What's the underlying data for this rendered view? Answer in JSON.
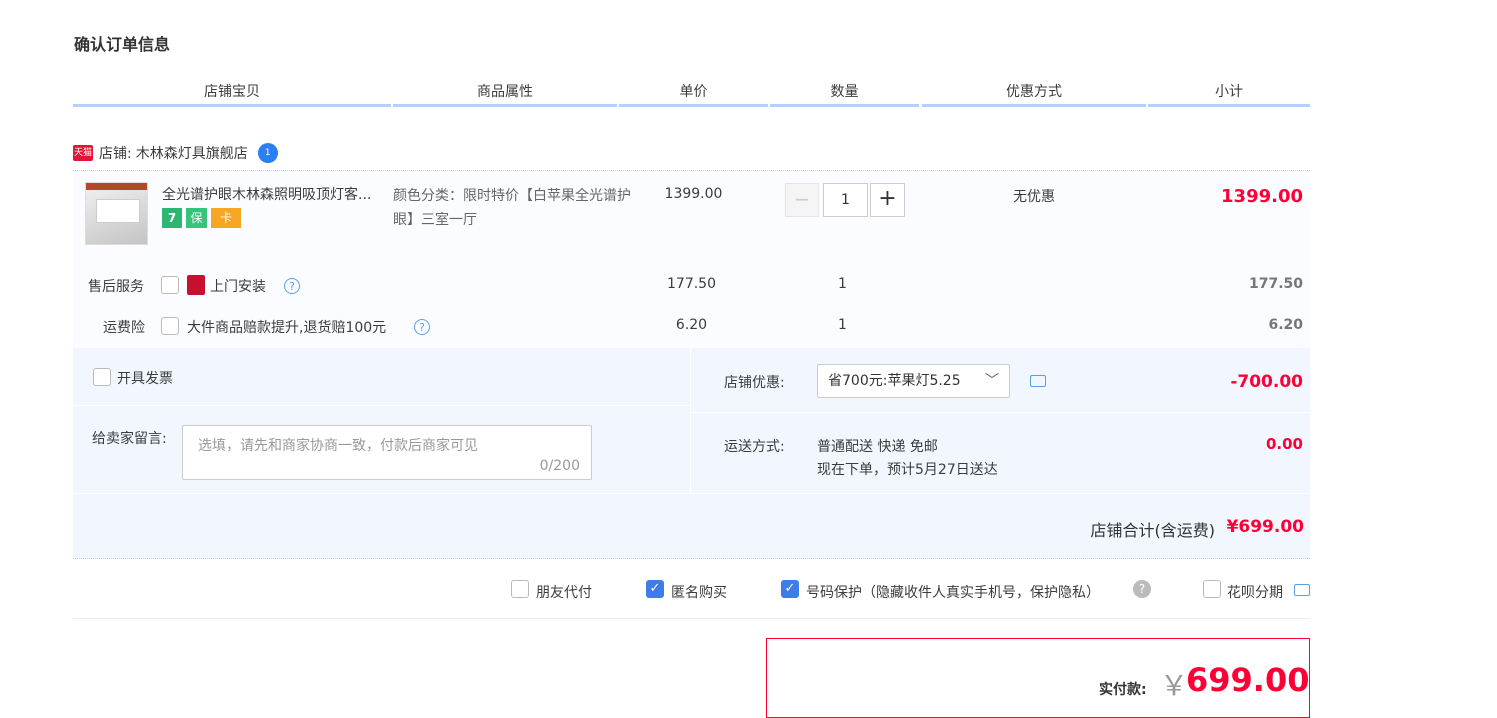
{
  "page_title": "确认订单信息",
  "columns": [
    "店铺宝贝",
    "商品属性",
    "单价",
    "数量",
    "优惠方式",
    "小计"
  ],
  "shop": {
    "tmall_badge": "天猫",
    "label": "店铺:",
    "name": "木林森灯具旗舰店",
    "chat_badge": "1"
  },
  "item": {
    "name": "全光谱护眼木林森照明吸顶灯客...",
    "badges": [
      "7",
      "保",
      "卡"
    ],
    "attribute": "颜色分类：限时特价【白苹果全光谱护眼】三室一厅",
    "price": "1399.00",
    "quantity": "1",
    "minus": "−",
    "plus": "+",
    "discount": "无优惠",
    "subtotal": "1399.00"
  },
  "service": {
    "label": "售后服务",
    "option": "上门安装",
    "price": "177.50",
    "qty": "1",
    "subtotal": "177.50"
  },
  "insurance": {
    "label": "运费险",
    "option": "大件商品赔款提升,退货赔100元",
    "price": "6.20",
    "qty": "1",
    "subtotal": "6.20"
  },
  "invoice": {
    "label": "开具发票"
  },
  "memo": {
    "label": "给卖家留言:",
    "placeholder": "选填，请先和商家协商一致，付款后商家可见",
    "counter": "0/200"
  },
  "shop_discount": {
    "label": "店铺优惠:",
    "selected": "省700元:苹果灯5.25",
    "amount": "-700.00"
  },
  "shipping": {
    "label": "运送方式:",
    "method": "普通配送 快递 免邮",
    "eta": "现在下单，预计5月27日送达",
    "amount": "0.00"
  },
  "shop_total": {
    "label": "店铺合计(含运费)",
    "amount": "¥699.00"
  },
  "options": {
    "friend_pay": "朋友代付",
    "anonymous": "匿名购买",
    "phone_protect": "号码保护（隐藏收件人真实手机号，保护隐私）",
    "huabei": "花呗分期"
  },
  "payment": {
    "label": "实付款:",
    "currency": "￥",
    "amount": "699.00"
  },
  "colors": {
    "accent_red": "#ff0036",
    "header_line": "#b2d1ff",
    "panel_bg": "#f2f7ff",
    "check_blue": "#3f7ce8"
  }
}
